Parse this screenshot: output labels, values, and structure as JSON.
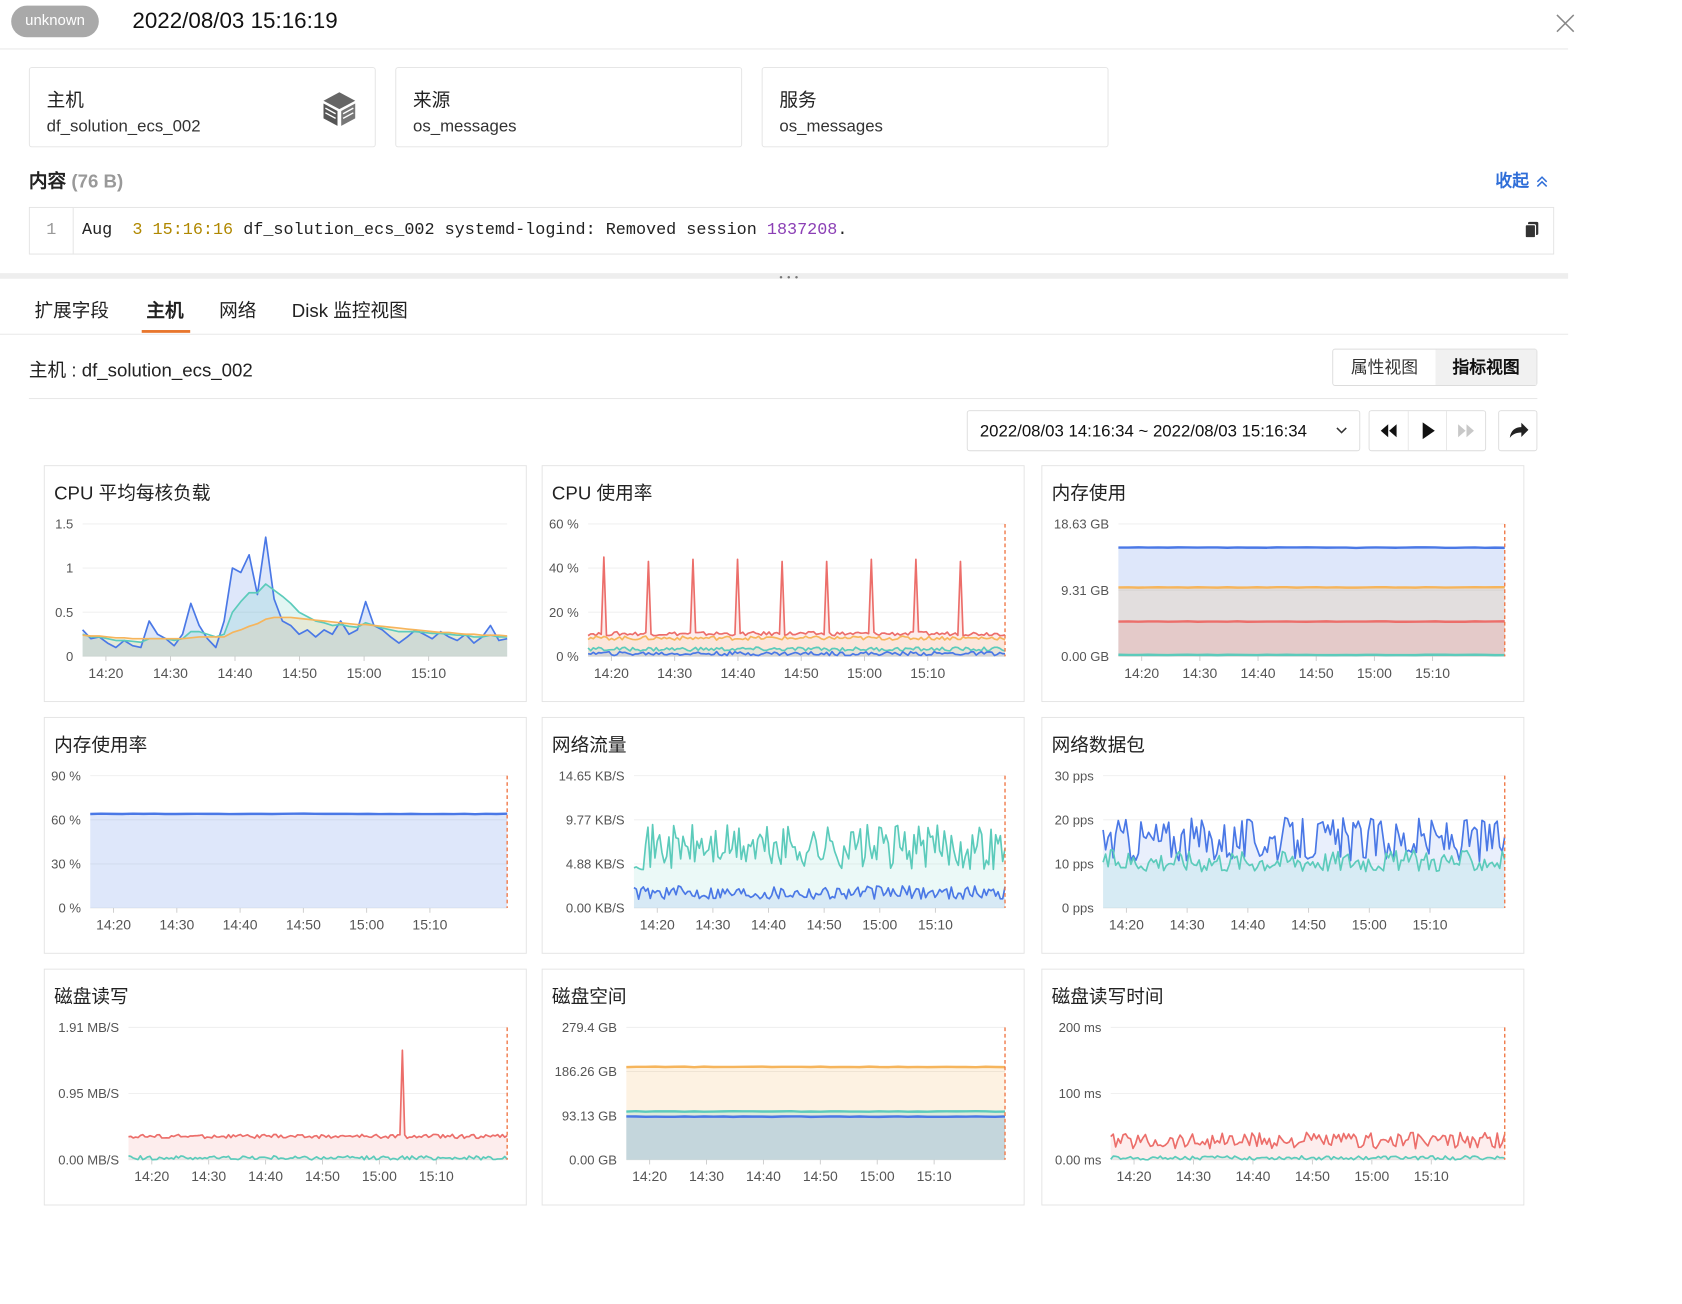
{
  "header": {
    "badge": "unknown",
    "time": "2022/08/03 15:16:19"
  },
  "cards": [
    {
      "label": "主机",
      "value": "df_solution_ecs_002",
      "icon": "server-cube-icon"
    },
    {
      "label": "来源",
      "value": "os_messages"
    },
    {
      "label": "服务",
      "value": "os_messages"
    }
  ],
  "content": {
    "title": "内容",
    "size": "(76 B)",
    "collapse_label": "收起",
    "line_number": "1",
    "log_parts": [
      "Aug  ",
      "3",
      " ",
      "15:16:16",
      " df_solution_ecs_002 systemd-logind: Removed session ",
      "1837208",
      "."
    ]
  },
  "tabs": [
    {
      "label": "扩展字段",
      "active": false
    },
    {
      "label": "主机",
      "active": true
    },
    {
      "label": "网络",
      "active": false
    },
    {
      "label": "Disk 监控视图",
      "active": false
    }
  ],
  "host_label": "主机 : df_solution_ecs_002",
  "view_switch": {
    "attr_view": "属性视图",
    "metric_view": "指标视图"
  },
  "time_range": "2022/08/03 14:16:34 ~ 2022/08/03 15:16:34",
  "colors": {
    "blue": "#4a78e6",
    "teal": "#5ccbbb",
    "orange": "#f6b55c",
    "red": "#ec6e6a",
    "accent": "#e8762c",
    "link": "#2f6ed8"
  },
  "chart_data": [
    {
      "title": "CPU 平均每核负载",
      "type": "line",
      "x_ticks": [
        "14:20",
        "14:30",
        "14:40",
        "14:50",
        "15:00",
        "15:10"
      ],
      "y_ticks": [
        "1.5",
        "1",
        "0.5",
        "0"
      ],
      "ylim": [
        0,
        1.5
      ],
      "series": [
        {
          "color": "blue",
          "values": [
            0.3,
            0.2,
            0.22,
            0.15,
            0.1,
            0.18,
            0.12,
            0.1,
            0.4,
            0.25,
            0.2,
            0.12,
            0.25,
            0.6,
            0.35,
            0.2,
            0.1,
            0.4,
            1.0,
            0.95,
            1.15,
            0.7,
            1.35,
            0.65,
            0.4,
            0.35,
            0.25,
            0.3,
            0.22,
            0.3,
            0.25,
            0.4,
            0.25,
            0.3,
            0.62,
            0.35,
            0.3,
            0.22,
            0.15,
            0.22,
            0.3,
            0.25,
            0.2,
            0.28,
            0.22,
            0.18,
            0.25,
            0.15,
            0.22,
            0.35,
            0.18,
            0.2
          ]
        },
        {
          "color": "teal",
          "values": [
            0.25,
            0.22,
            0.22,
            0.2,
            0.18,
            0.18,
            0.17,
            0.16,
            0.2,
            0.2,
            0.2,
            0.18,
            0.2,
            0.28,
            0.28,
            0.25,
            0.22,
            0.25,
            0.5,
            0.62,
            0.72,
            0.72,
            0.82,
            0.75,
            0.68,
            0.6,
            0.5,
            0.45,
            0.4,
            0.38,
            0.35,
            0.36,
            0.34,
            0.33,
            0.38,
            0.35,
            0.32,
            0.3,
            0.28,
            0.28,
            0.28,
            0.27,
            0.26,
            0.26,
            0.25,
            0.24,
            0.24,
            0.22,
            0.22,
            0.24,
            0.22,
            0.22
          ]
        },
        {
          "color": "orange",
          "values": [
            0.24,
            0.23,
            0.23,
            0.22,
            0.21,
            0.21,
            0.2,
            0.2,
            0.2,
            0.2,
            0.2,
            0.2,
            0.2,
            0.21,
            0.22,
            0.22,
            0.22,
            0.22,
            0.27,
            0.3,
            0.34,
            0.37,
            0.42,
            0.44,
            0.44,
            0.44,
            0.43,
            0.42,
            0.41,
            0.4,
            0.39,
            0.38,
            0.37,
            0.36,
            0.36,
            0.35,
            0.34,
            0.33,
            0.32,
            0.31,
            0.3,
            0.29,
            0.28,
            0.27,
            0.27,
            0.26,
            0.25,
            0.25,
            0.24,
            0.24,
            0.24,
            0.23
          ]
        }
      ]
    },
    {
      "title": "CPU 使用率",
      "type": "line",
      "x_ticks": [
        "14:20",
        "14:30",
        "14:40",
        "14:50",
        "15:00",
        "15:10"
      ],
      "y_ticks": [
        "60 %",
        "40 %",
        "20 %",
        "0 %"
      ],
      "ylim": [
        0,
        60
      ],
      "now_marker": true,
      "series": [
        {
          "color": "red",
          "spikes": [
            45,
            43,
            44,
            44,
            43,
            43,
            44,
            44,
            43
          ],
          "base": 10
        },
        {
          "color": "orange",
          "base": 8
        },
        {
          "color": "teal",
          "base": 3
        },
        {
          "color": "blue",
          "base": 1
        }
      ]
    },
    {
      "title": "内存使用",
      "type": "area",
      "x_ticks": [
        "14:20",
        "14:30",
        "14:40",
        "14:50",
        "15:00",
        "15:10"
      ],
      "y_ticks": [
        "18.63 GB",
        "9.31 GB",
        "0.00 GB"
      ],
      "ylim": [
        0,
        18.63
      ],
      "now_marker": true,
      "series": [
        {
          "color": "blue",
          "values": [
            15.3
          ]
        },
        {
          "color": "orange",
          "values": [
            9.7
          ]
        },
        {
          "color": "red",
          "values": [
            4.9
          ]
        },
        {
          "color": "teal",
          "values": [
            0.2
          ]
        }
      ]
    },
    {
      "title": "内存使用率",
      "type": "area",
      "x_ticks": [
        "14:20",
        "14:30",
        "14:40",
        "14:50",
        "15:00",
        "15:10"
      ],
      "y_ticks": [
        "90 %",
        "60 %",
        "30 %",
        "0 %"
      ],
      "ylim": [
        0,
        90
      ],
      "now_marker": true,
      "series": [
        {
          "color": "blue",
          "values": [
            64
          ]
        }
      ]
    },
    {
      "title": "网络流量",
      "type": "line",
      "x_ticks": [
        "14:20",
        "14:30",
        "14:40",
        "14:50",
        "15:00",
        "15:10"
      ],
      "y_ticks": [
        "14.65 KB/S",
        "9.77 KB/S",
        "4.88 KB/S",
        "0.00 KB/S"
      ],
      "ylim": [
        0,
        14.65
      ],
      "now_marker": true,
      "series": [
        {
          "color": "teal",
          "base": 6,
          "amp": 5
        },
        {
          "color": "blue",
          "base": 1.5,
          "amp": 1.5
        }
      ]
    },
    {
      "title": "网络数据包",
      "type": "line",
      "x_ticks": [
        "14:20",
        "14:30",
        "14:40",
        "14:50",
        "15:00",
        "15:10"
      ],
      "y_ticks": [
        "30 pps",
        "20 pps",
        "10 pps",
        "0 pps"
      ],
      "ylim": [
        0,
        30
      ],
      "now_marker": true,
      "series": [
        {
          "color": "blue",
          "base": 14,
          "amp": 10
        },
        {
          "color": "teal",
          "base": 10,
          "amp": 5
        }
      ]
    },
    {
      "title": "磁盘读写",
      "type": "line",
      "x_ticks": [
        "14:20",
        "14:30",
        "14:40",
        "14:50",
        "15:00",
        "15:10"
      ],
      "y_ticks": [
        "1.91 MB/S",
        "0.95 MB/S",
        "0.00 MB/S"
      ],
      "ylim": [
        0,
        1.91
      ],
      "now_marker": true,
      "series": [
        {
          "color": "red",
          "base": 0.33,
          "spike": 1.58
        },
        {
          "color": "teal",
          "base": 0.02
        }
      ]
    },
    {
      "title": "磁盘空间",
      "type": "area",
      "x_ticks": [
        "14:20",
        "14:30",
        "14:40",
        "14:50",
        "15:00",
        "15:10"
      ],
      "y_ticks": [
        "279.4 GB",
        "186.26 GB",
        "93.13 GB",
        "0.00 GB"
      ],
      "ylim": [
        0,
        279.4
      ],
      "now_marker": true,
      "series": [
        {
          "color": "orange",
          "values": [
            196
          ]
        },
        {
          "color": "teal",
          "values": [
            102
          ]
        },
        {
          "color": "blue",
          "values": [
            91
          ]
        }
      ]
    },
    {
      "title": "磁盘读写时间",
      "type": "line",
      "x_ticks": [
        "14:20",
        "14:30",
        "14:40",
        "14:50",
        "15:00",
        "15:10"
      ],
      "y_ticks": [
        "200 ms",
        "100 ms",
        "0.00 ms"
      ],
      "ylim": [
        0,
        200
      ],
      "now_marker": true,
      "series": [
        {
          "color": "red",
          "base": 25,
          "amp": 25
        },
        {
          "color": "teal",
          "base": 2
        }
      ]
    }
  ]
}
